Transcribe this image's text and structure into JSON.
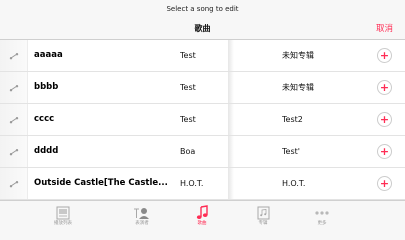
{
  "header": {
    "prompt": "Select a song to edit",
    "title": "歌曲",
    "cancel_label": "取消"
  },
  "songs": [
    {
      "title": "aaaaa",
      "artist": "Test",
      "album": "未知专辑"
    },
    {
      "title": "bbbb",
      "artist": "Test",
      "album": "未知专辑"
    },
    {
      "title": "cccc",
      "artist": "Test",
      "album": "Test2"
    },
    {
      "title": "dddd",
      "artist": "Boa",
      "album": "Test'"
    },
    {
      "title": "Outside Castle[The Castle...",
      "artist": "H.O.T.",
      "album": "H.O.T."
    }
  ],
  "row_icon": "music-note-icon",
  "add_icon": "plus-icon",
  "tabs": [
    {
      "label": "播放列表",
      "icon": "playlist-icon"
    },
    {
      "label": "表演者",
      "icon": "artist-icon"
    },
    {
      "label": "歌曲",
      "icon": "music-note-icon",
      "active": true
    },
    {
      "label": "专辑",
      "icon": "album-icon"
    },
    {
      "label": "更多",
      "icon": "more-icon"
    }
  ],
  "colors": {
    "accent": "#ff2d55",
    "inactive_tab": "#999999"
  }
}
